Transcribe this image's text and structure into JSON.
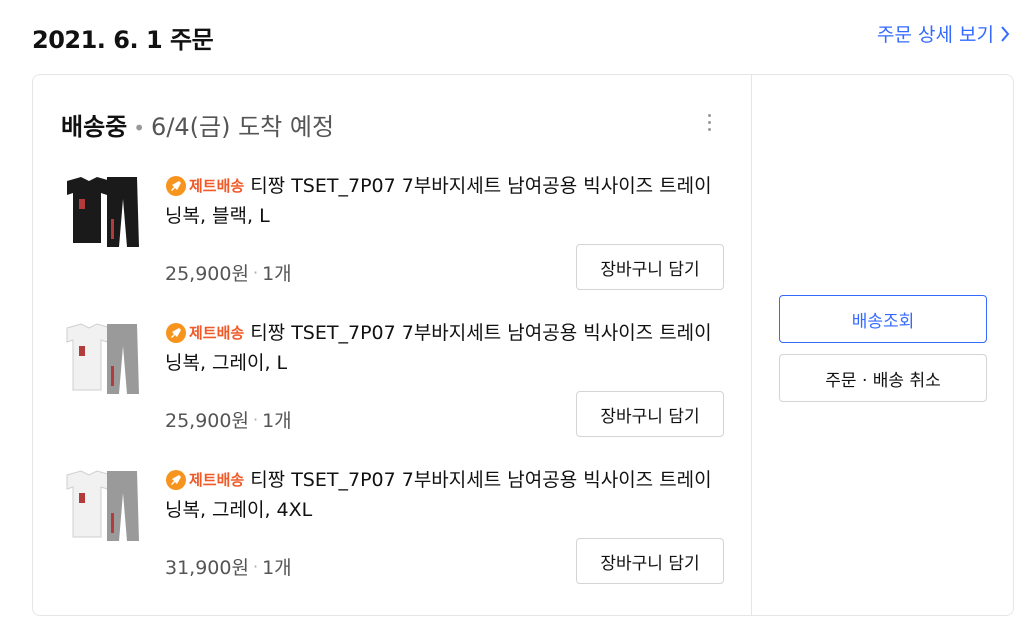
{
  "order": {
    "date_title": "2021. 6. 1 주문",
    "detail_link": "주문 상세 보기"
  },
  "shipment": {
    "status": "배송중",
    "eta": "6/4(금) 도착 예정"
  },
  "items": [
    {
      "badge": "제트배송",
      "title": "티짱 TSET_7P07 7부바지세트 남여공용 빅사이즈 트레이닝복, 블랙, L",
      "price": "25,900원",
      "qty": "1개",
      "cart_label": "장바구니 담기",
      "thumb_color": "black"
    },
    {
      "badge": "제트배송",
      "title": "티짱 TSET_7P07 7부바지세트 남여공용 빅사이즈 트레이닝복, 그레이, L",
      "price": "25,900원",
      "qty": "1개",
      "cart_label": "장바구니 담기",
      "thumb_color": "gray"
    },
    {
      "badge": "제트배송",
      "title": "티짱 TSET_7P07 7부바지세트 남여공용 빅사이즈 트레이닝복, 그레이, 4XL",
      "price": "31,900원",
      "qty": "1개",
      "cart_label": "장바구니 담기",
      "thumb_color": "gray"
    }
  ],
  "actions": {
    "track": "배송조회",
    "cancel": "주문 · 배송 취소"
  },
  "colors": {
    "accent": "#346aff",
    "badge": "#f05a28",
    "border": "#e6e6e6"
  },
  "icons": {
    "more": "more-vertical-icon",
    "chevron": "chevron-right-icon",
    "rocket": "rocket-icon"
  }
}
